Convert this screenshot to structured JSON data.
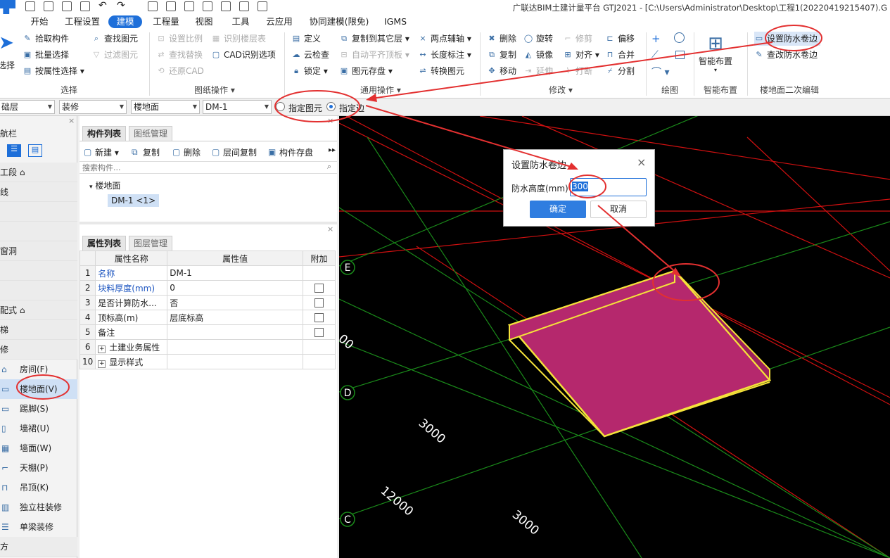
{
  "window": {
    "title": "广联达BIM土建计量平台 GTJ2021 - [C:\\Users\\Administrator\\Desktop\\工程1(20220419215407).G"
  },
  "menu": [
    "开始",
    "工程设置",
    "建模",
    "工程量",
    "视图",
    "工具",
    "云应用",
    "协同建模(限免)",
    "IGMS"
  ],
  "ribbon": {
    "select": {
      "big": "选择",
      "items": [
        "拾取构件",
        "批量选择",
        "按属性选择",
        "查找图元",
        "过滤图元"
      ],
      "label": "选择"
    },
    "drawing": {
      "items": [
        "设置比例",
        "识别楼层表",
        "查找替换",
        "CAD识别选项",
        "还原CAD"
      ],
      "label": "图纸操作"
    },
    "common": {
      "items": [
        "定义",
        "复制到其它层",
        "两点辅轴",
        "云检查",
        "自动平齐顶板",
        "长度标注",
        "锁定",
        "图元存盘",
        "转换图元"
      ],
      "label": "通用操作"
    },
    "modify": {
      "items": [
        "删除",
        "旋转",
        "修剪",
        "偏移",
        "复制",
        "镜像",
        "对齐",
        "合并",
        "移动",
        "延伸",
        "打断",
        "分割"
      ],
      "label": "修改"
    },
    "draw": {
      "label": "绘图"
    },
    "smart": {
      "big": "智能布置",
      "label": "智能布置"
    },
    "floor2": {
      "items": [
        "设置防水卷边",
        "查改防水卷边"
      ],
      "label": "楼地面二次编辑"
    }
  },
  "filters": {
    "floor": "础层",
    "category": "装修",
    "type": "楼地面",
    "component": "DM-1",
    "radio1": "指定图元",
    "radio2": "指定边"
  },
  "nav": {
    "title": "航栏",
    "rows": [
      "工段",
      "线",
      "",
      "",
      "窗洞",
      "",
      "",
      "配式",
      "梯",
      "修"
    ],
    "items": [
      "房间(F)",
      "楼地面(V)",
      "踢脚(S)",
      "墙裙(U)",
      "墙面(W)",
      "天棚(P)",
      "吊顶(K)",
      "独立柱装修",
      "单梁装修"
    ],
    "bottom": "方"
  },
  "components": {
    "tabs": [
      "构件列表",
      "图纸管理"
    ],
    "toolbar": [
      "新建",
      "复制",
      "删除",
      "层间复制",
      "构件存盘"
    ],
    "search_placeholder": "搜索构件...",
    "tree_root": "楼地面",
    "tree_item": "DM-1 <1>"
  },
  "properties": {
    "tabs": [
      "属性列表",
      "图层管理"
    ],
    "headers": [
      "属性名称",
      "属性值",
      "附加"
    ],
    "rows": [
      {
        "no": "1",
        "name": "名称",
        "value": "DM-1",
        "check": false,
        "blue": true
      },
      {
        "no": "2",
        "name": "块料厚度(mm)",
        "value": "0",
        "check": true,
        "blue": true
      },
      {
        "no": "3",
        "name": "是否计算防水...",
        "value": "否",
        "check": true,
        "blue": false
      },
      {
        "no": "4",
        "name": "顶标高(m)",
        "value": "层底标高",
        "check": true,
        "blue": false
      },
      {
        "no": "5",
        "name": "备注",
        "value": "",
        "check": true,
        "blue": false
      },
      {
        "no": "6",
        "name": "土建业务属性",
        "value": "",
        "check": false,
        "blue": false,
        "expand": true
      },
      {
        "no": "10",
        "name": "显示样式",
        "value": "",
        "check": false,
        "blue": false,
        "expand": true
      }
    ]
  },
  "canvas": {
    "axis_labels": [
      "E",
      "D",
      "C"
    ],
    "dims": [
      "3000",
      "12000",
      "3000",
      "00"
    ]
  },
  "dialog": {
    "title": "设置防水卷边",
    "label": "防水高度(mm)",
    "value": "300",
    "ok": "确定",
    "cancel": "取消"
  },
  "colors": {
    "accent": "#1e6fd9",
    "slab": "#b5286d",
    "edge": "#f5e23a",
    "grid_red": "#d01010",
    "grid_green": "#1a8a1a",
    "annot": "#e33030"
  }
}
